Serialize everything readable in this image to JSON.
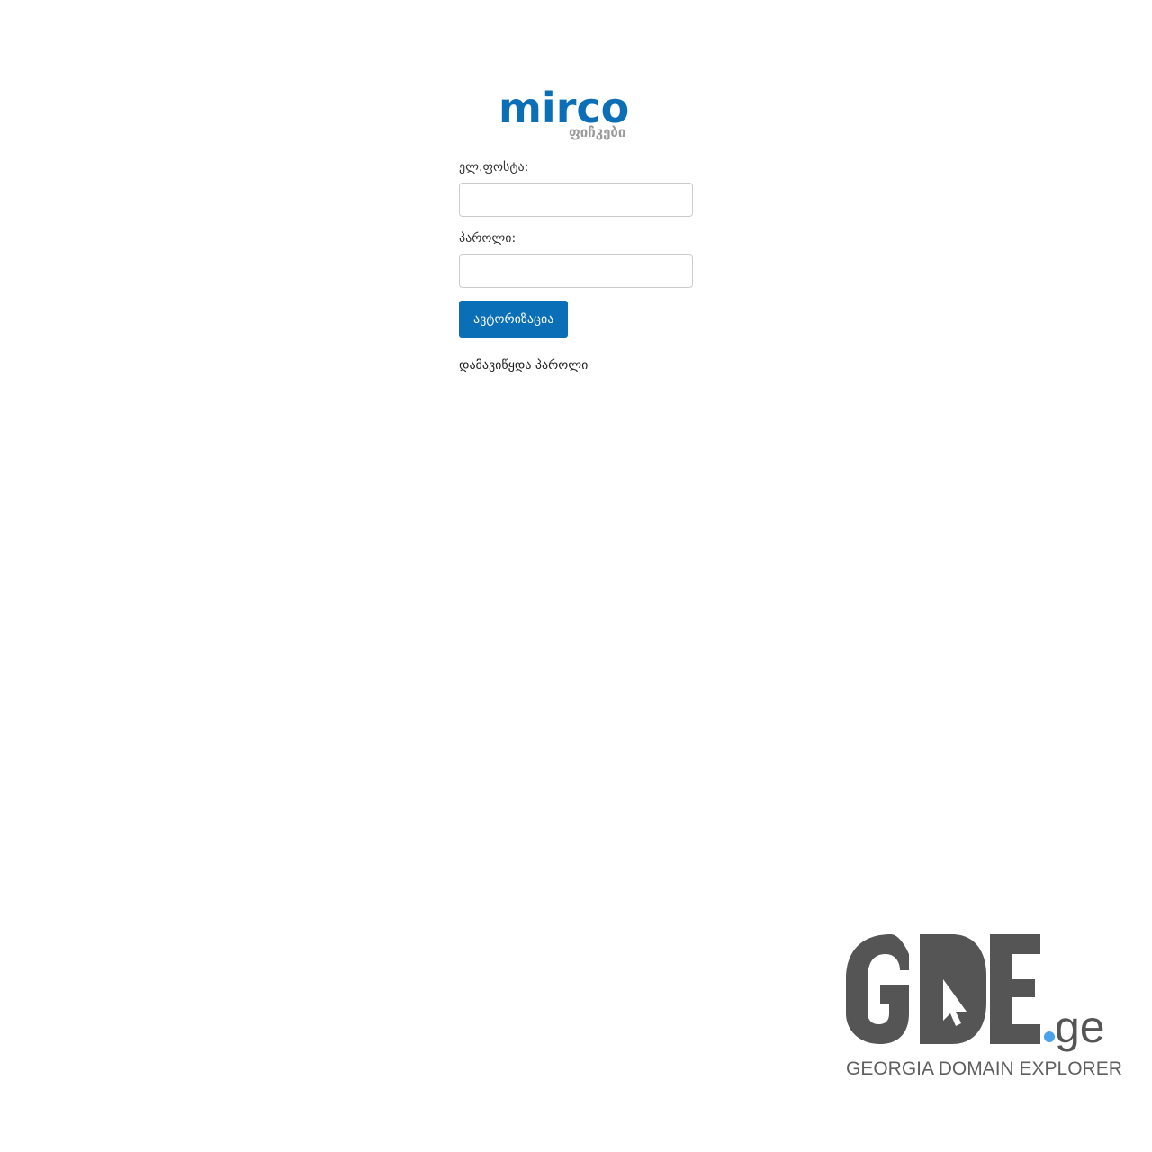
{
  "logo": {
    "brand": "mirco",
    "sub": "ფიჩკები",
    "colors": {
      "primary": "#0b6fb8",
      "accent": "#9a9a9a"
    }
  },
  "form": {
    "email_label": "ელ.ფოსტა:",
    "email_value": "",
    "password_label": "პაროლი:",
    "password_value": "",
    "submit_label": "ავტორიზაცია",
    "forgot_label": "დამავიწყდა პაროლი"
  },
  "watermark": {
    "logo_text": "GDE",
    "tld": ".ge",
    "caption": "GEORGIA DOMAIN EXPLORER",
    "colors": {
      "dark": "#555555",
      "dot": "#4aa3ea"
    }
  }
}
